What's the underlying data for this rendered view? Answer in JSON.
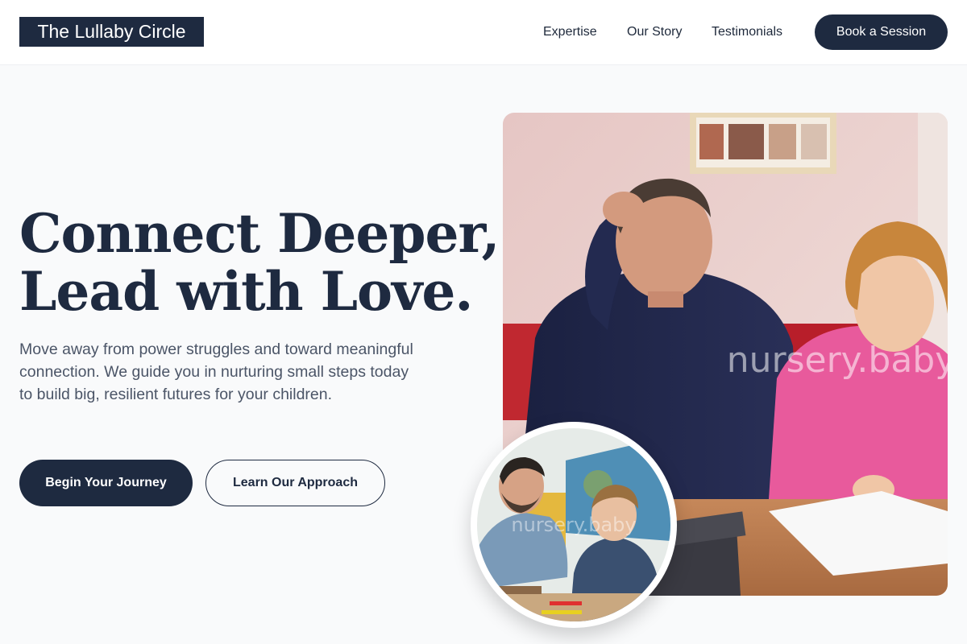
{
  "header": {
    "logo": "The Lullaby Circle",
    "nav": [
      {
        "label": "Expertise"
      },
      {
        "label": "Our Story"
      },
      {
        "label": "Testimonials"
      }
    ],
    "cta_label": "Book a Session"
  },
  "hero": {
    "headline_line1": "Connect Deeper,",
    "headline_line2": "Lead with Love.",
    "subtext": "Move away from power struggles and toward meaningful connection. We guide you in nurturing small steps today to build big, resilient futures for your children.",
    "primary_label": "Begin Your Journey",
    "secondary_label": "Learn Our Approach"
  },
  "images": {
    "main_watermark": "nursery.baby",
    "inset_watermark": "nursery.baby"
  },
  "colors": {
    "brand_navy": "#1e2a40",
    "page_bg": "#f9fafb",
    "body_text": "#4b5567"
  }
}
